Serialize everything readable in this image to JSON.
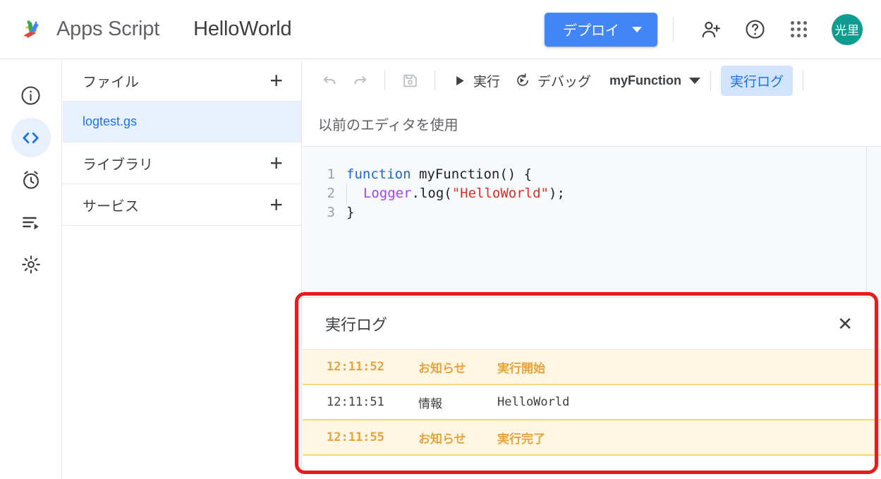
{
  "topbar": {
    "logo_icon": "apps-script-logo",
    "brand": "Apps Script",
    "project_title": "HelloWorld",
    "deploy_label": "デプロイ",
    "deploy_caret_icon": "chevron-down-icon",
    "add_person_icon": "person-add-icon",
    "help_icon": "help-circle-icon",
    "apps_grid_icon": "apps-grid-icon",
    "avatar_initials": "光里",
    "accent_blue": "#4285f4",
    "avatar_color": "#0f9d92"
  },
  "rail": {
    "items": [
      {
        "name": "overview",
        "icon": "info-circle-icon",
        "active": false
      },
      {
        "name": "editor",
        "icon": "code-brackets-icon",
        "active": true
      },
      {
        "name": "triggers",
        "icon": "alarm-clock-icon",
        "active": false
      },
      {
        "name": "executions",
        "icon": "executions-list-icon",
        "active": false
      },
      {
        "name": "settings",
        "icon": "gear-icon",
        "active": false
      }
    ]
  },
  "file_panel": {
    "files_label": "ファイル",
    "libraries_label": "ライブラリ",
    "services_label": "サービス",
    "add_icon": "plus-icon",
    "selected_file": "logtest.gs"
  },
  "editor_toolbar": {
    "undo_icon": "undo-icon",
    "redo_icon": "redo-icon",
    "save_icon": "save-icon",
    "run_label": "実行",
    "run_icon": "play-triangle-icon",
    "debug_label": "デバッグ",
    "debug_icon": "debug-icon",
    "function_selected": "myFunction",
    "function_caret_icon": "chevron-down-icon",
    "log_toggle_label": "実行ログ"
  },
  "editor_subbar": {
    "legacy_editor_label": "以前のエディタを使用"
  },
  "code": {
    "lines": [
      {
        "number": "1",
        "indent": false,
        "tokens": [
          {
            "t": "function ",
            "c": "tok-kw"
          },
          {
            "t": "myFunction() {",
            "c": "tok-plain"
          }
        ]
      },
      {
        "number": "2",
        "indent": true,
        "tokens": [
          {
            "t": "  Logger",
            "c": "tok-cls"
          },
          {
            "t": ".log(",
            "c": "tok-plain"
          },
          {
            "t": "\"HelloWorld\"",
            "c": "tok-str"
          },
          {
            "t": ");",
            "c": "tok-plain"
          }
        ]
      },
      {
        "number": "3",
        "indent": false,
        "tokens": [
          {
            "t": "}",
            "c": "tok-plain"
          }
        ]
      }
    ]
  },
  "log_panel": {
    "title": "実行ログ",
    "close_icon": "close-x-icon",
    "rows": [
      {
        "time": "12:11:52",
        "level": "お知らせ",
        "message": "実行開始",
        "kind": "notice"
      },
      {
        "time": "12:11:51",
        "level": "情報",
        "message": "HelloWorld",
        "kind": "info"
      },
      {
        "time": "12:11:55",
        "level": "お知らせ",
        "message": "実行完了",
        "kind": "notice"
      }
    ],
    "notice_color": "#e8a33d",
    "notice_bg": "#fdf6e3",
    "info_bg": "#ffffff"
  },
  "annotation": {
    "name": "red-highlight-box",
    "color": "#e81c1c"
  }
}
